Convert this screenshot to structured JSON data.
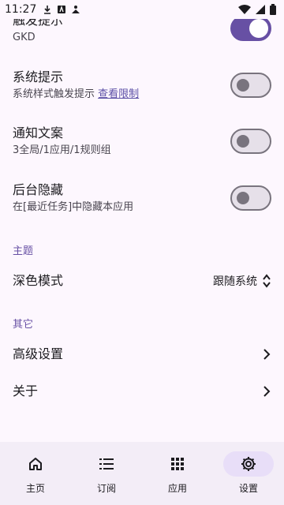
{
  "status_bar": {
    "time": "11:27"
  },
  "settings": {
    "trigger_tip": {
      "title": "触发提示",
      "subtitle": "GKD",
      "enabled": true
    },
    "system_tip": {
      "title": "系统提示",
      "subtitle": "系统样式触发提示",
      "link": "查看限制",
      "enabled": false
    },
    "notification_text": {
      "title": "通知文案",
      "subtitle": "3全局/1应用/1规则组",
      "enabled": false
    },
    "background_hide": {
      "title": "后台隐藏",
      "subtitle": "在[最近任务]中隐藏本应用",
      "enabled": false
    },
    "theme_section": "主题",
    "dark_mode": {
      "title": "深色模式",
      "value": "跟随系统"
    },
    "other_section": "其它",
    "advanced": {
      "title": "高级设置"
    },
    "about": {
      "title": "关于"
    }
  },
  "nav": [
    {
      "label": "主页",
      "icon": "home-icon"
    },
    {
      "label": "订阅",
      "icon": "list-icon"
    },
    {
      "label": "应用",
      "icon": "apps-grid-icon"
    },
    {
      "label": "设置",
      "icon": "gear-icon",
      "active": true
    }
  ]
}
